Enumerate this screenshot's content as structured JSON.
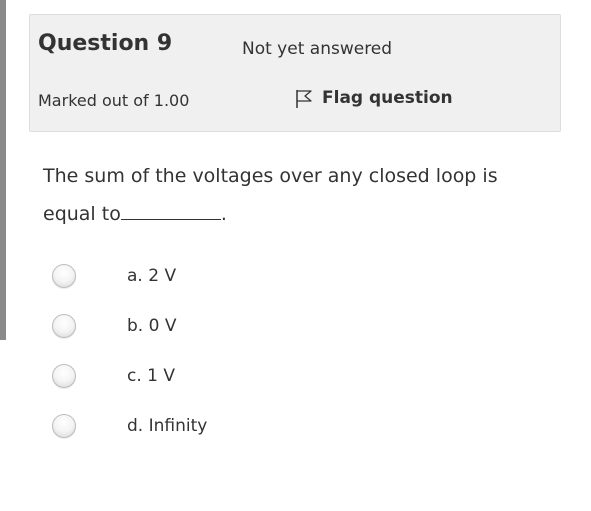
{
  "question": {
    "title": "Question 9",
    "state": "Not yet answered",
    "grade": "Marked out of 1.00",
    "flag_label": "Flag question",
    "text_before_blank": "The sum of the voltages over any closed loop is equal to",
    "text_after_blank": "."
  },
  "options": [
    {
      "label": "a. 2 V",
      "selected": false
    },
    {
      "label": "b. 0 V",
      "selected": false
    },
    {
      "label": "c. 1 V",
      "selected": false
    },
    {
      "label": "d. Infinity",
      "selected": false
    }
  ],
  "colors": {
    "panel_bg": "#f0f0f0",
    "text": "#333333",
    "left_bar": "#8a8a8a"
  }
}
